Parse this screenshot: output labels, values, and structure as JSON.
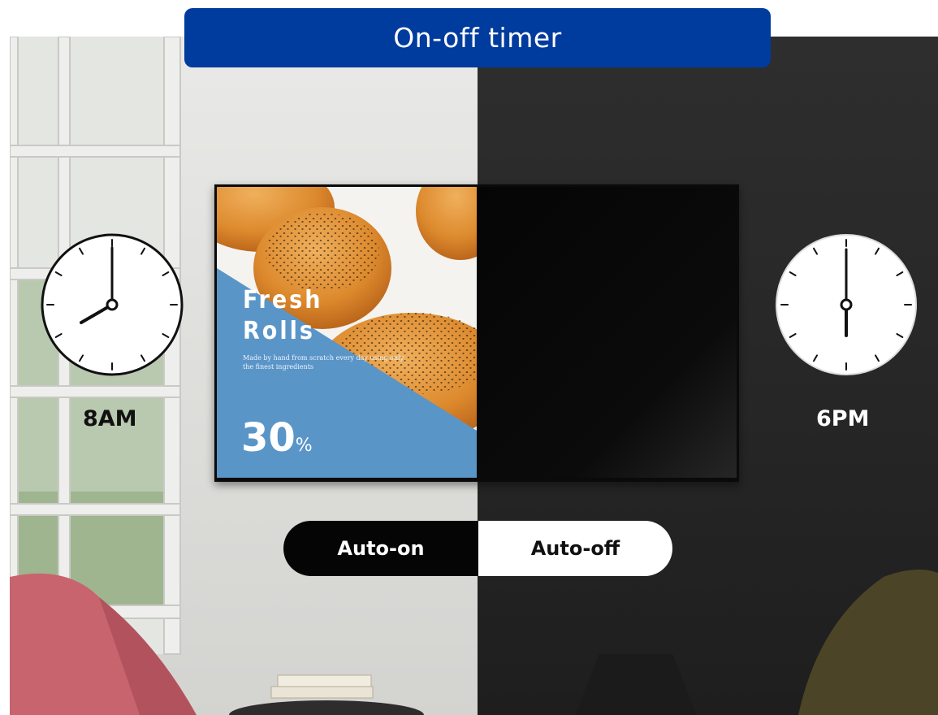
{
  "title": "On-off timer",
  "clocks": {
    "on_time": "8AM",
    "off_time": "6PM"
  },
  "display": {
    "heading": "Fresh\nRolls",
    "subtext": "Made by hand from scratch every day using only the finest ingredients",
    "discount_value": "30",
    "discount_sign": "%"
  },
  "toggle": {
    "on_label": "Auto-on",
    "off_label": "Auto-off"
  },
  "colors": {
    "title_bar": "#003b9e",
    "promo_blue": "#5a95c8",
    "dark_room": "#2a2a2a"
  }
}
